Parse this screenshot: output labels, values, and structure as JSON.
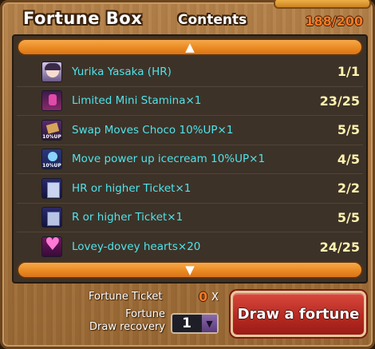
{
  "header": {
    "title": "Fortune Box",
    "subtitle": "Contents",
    "count": "188/200"
  },
  "list": {
    "scroll_up_icon": "triangle-up-icon",
    "scroll_down_icon": "triangle-down-icon",
    "items": [
      {
        "icon": "character-portrait-icon",
        "name": "Yurika Yasaka (HR)",
        "qty": "1/1"
      },
      {
        "icon": "stamina-potion-icon",
        "name": "Limited Mini Stamina×1",
        "qty": "23/25"
      },
      {
        "icon": "choco-icon",
        "name": "Swap Moves Choco 10%UP×1",
        "qty": "5/5"
      },
      {
        "icon": "icecream-icon",
        "name": "Move power up icecream 10%UP×1",
        "qty": "4/5"
      },
      {
        "icon": "ticket-icon",
        "name": "HR or higher Ticket×1",
        "qty": "2/2"
      },
      {
        "icon": "ticket-icon",
        "name": "R or higher Ticket×1",
        "qty": "5/5"
      },
      {
        "icon": "hearts-icon",
        "name": "Lovey-dovey hearts×20",
        "qty": "24/25"
      }
    ]
  },
  "footer": {
    "ticket_label": "Fortune Ticket",
    "ticket_count": "0",
    "ticket_x": "X",
    "recovery_label_line1": "Fortune",
    "recovery_label_line2": "Draw recovery",
    "recovery_value": "1",
    "draw_button": "Draw a fortune"
  },
  "colors": {
    "accent_orange": "#ea8a22",
    "item_name": "#4fe3ea",
    "qty": "#fff3b0",
    "draw_button": "#b82a22"
  }
}
